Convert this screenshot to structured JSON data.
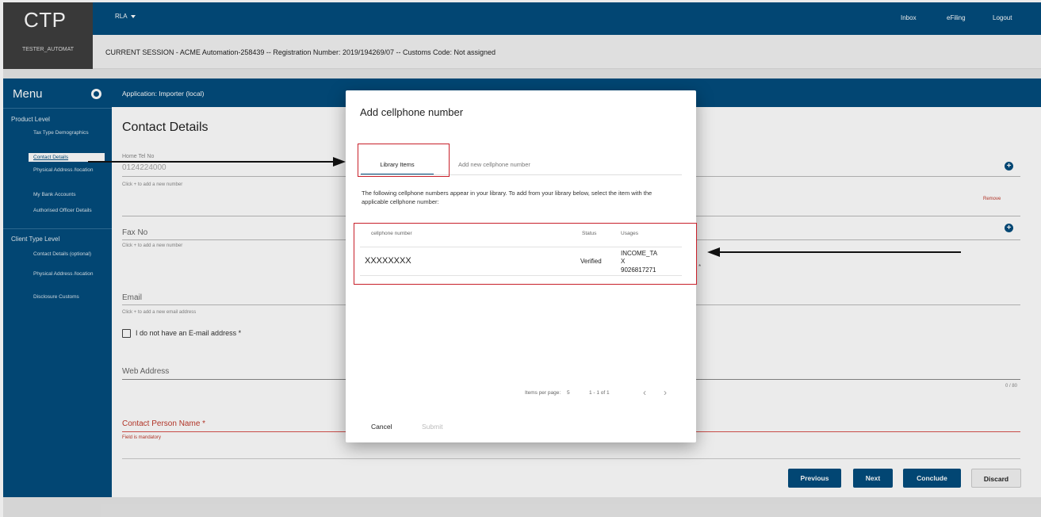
{
  "app": {
    "logo": "CTP",
    "user": "TESTER_AUTOMAT",
    "rla_label": "RLA",
    "nav": {
      "inbox": "Inbox",
      "efiling": "eFiling",
      "logout": "Logout"
    },
    "session": "CURRENT SESSION - ACME Automation-258439 -- Registration Number: 2019/194269/07 -- Customs Code: Not assigned",
    "application_title": "Application: Importer (local)"
  },
  "sidebar": {
    "title": "Menu",
    "product_level": {
      "heading": "Product Level",
      "items": [
        "Tax Type Demographics",
        "Contact Details",
        "Physical Address /location",
        "My Bank Accounts",
        "Authorised Officer Details"
      ]
    },
    "client_type_level": {
      "heading": "Client Type Level",
      "items": [
        "Contact Details (optional)",
        "Physical Address /location",
        "Disclosure Customs"
      ]
    }
  },
  "main": {
    "title": "Contact Details",
    "home_tel_label": "Home Tel No",
    "home_tel_value": "0124224000",
    "home_tel_hint": "Click + to add a new number",
    "remove_label": "Remove",
    "fax_label": "Fax No",
    "fax_hint": "Click + to add a new number",
    "email_label": "Email",
    "email_hint": "Click + to add a new email address",
    "no_email_label": "I do not have an E-mail address *",
    "web_label": "Web Address",
    "web_counter": "0 / 80",
    "contact_person_label": "Contact Person Name *",
    "contact_person_error": "Field is mandatory",
    "buttons": {
      "previous": "Previous",
      "next": "Next",
      "conclude": "Conclude",
      "discard": "Discard"
    }
  },
  "dialog": {
    "title": "Add cellphone number",
    "tabs": [
      "Library Items",
      "Add new cellphone number"
    ],
    "intro": "The following cellphone numbers appear in your library. To add from your library below, select the item with the applicable cellphone number:",
    "columns": [
      "cellphone number",
      "Status",
      "Usages"
    ],
    "rows": [
      {
        "number": "XXXXXXXX",
        "status": "Verified",
        "usage_line1": "INCOME_TA",
        "usage_line2": "X",
        "usage_line3": "9026817271"
      }
    ],
    "items_per_page_label": "Items per page:",
    "items_per_page_value": "5",
    "range": "1 - 1 of 1",
    "cancel": "Cancel",
    "submit": "Submit"
  },
  "colors": {
    "brand": "#034d7d",
    "annotation": "#c8202a",
    "error": "#c0392b"
  }
}
